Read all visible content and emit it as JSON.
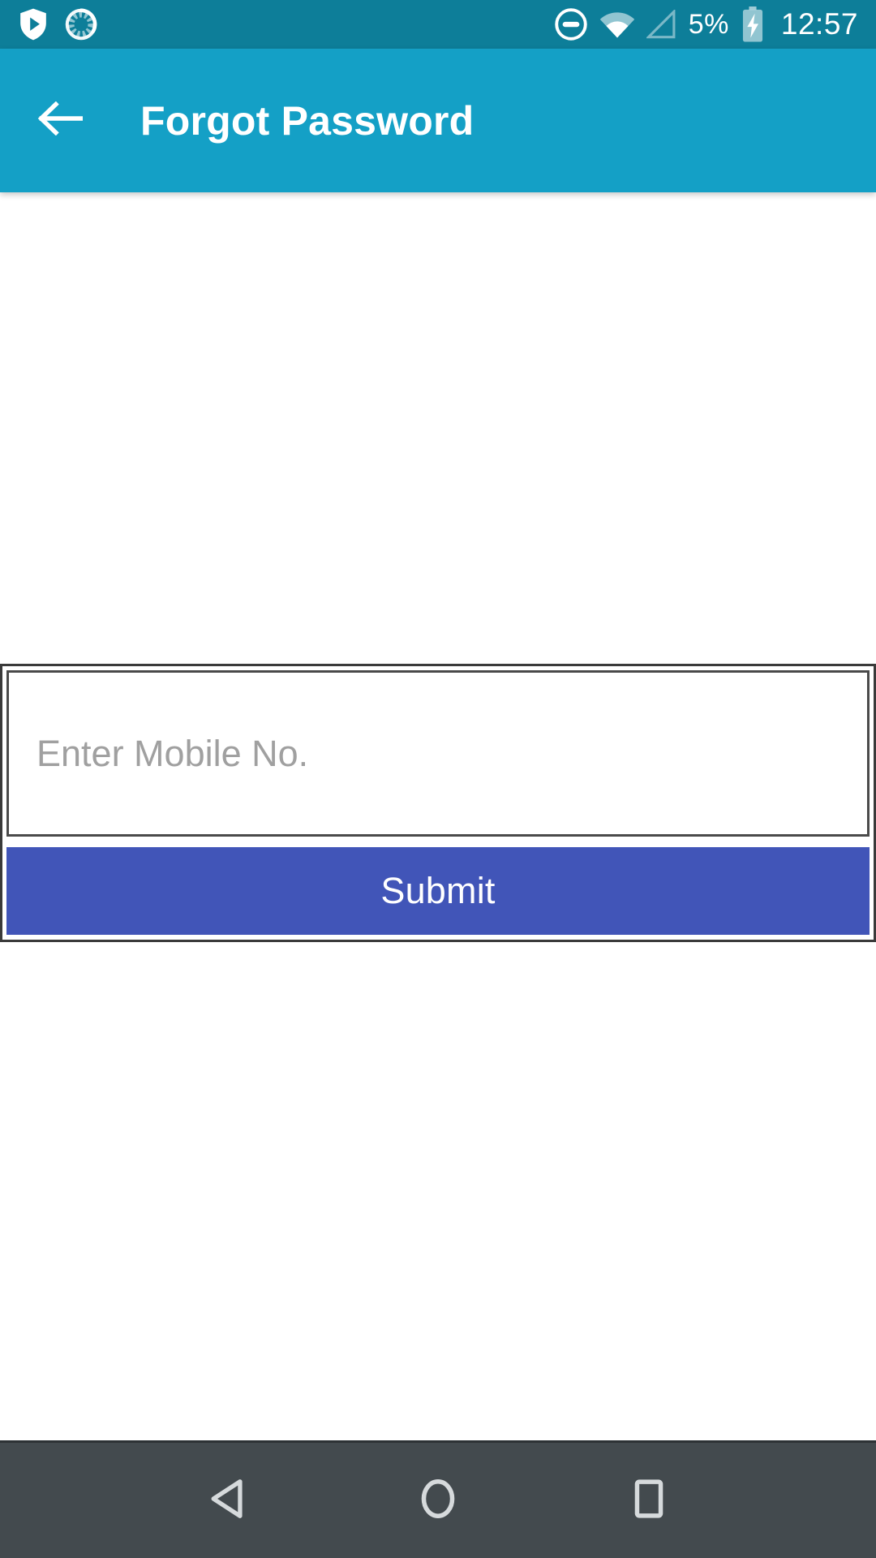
{
  "status_bar": {
    "background_color": "#0d7e99",
    "left_icons": [
      {
        "name": "shield-play-icon",
        "label": "shield-play"
      },
      {
        "name": "sync-spinner-icon",
        "label": "sync-spinner"
      }
    ],
    "right_icons": [
      {
        "name": "do-not-disturb-icon",
        "label": "do-not-disturb"
      },
      {
        "name": "wifi-icon",
        "label": "wifi"
      },
      {
        "name": "cellular-signal-icon",
        "label": "cellular-signal-empty"
      },
      {
        "name": "battery-charging-icon",
        "label": "battery-charging"
      }
    ],
    "battery_percent": "5%",
    "clock": "12:57"
  },
  "app_bar": {
    "background_color": "#14a0c6",
    "back_icon": "arrow-left-icon",
    "title": "Forgot Password"
  },
  "form": {
    "mobile_input": {
      "value": "",
      "placeholder": "Enter Mobile No."
    },
    "submit_label": "Submit",
    "submit_color": "#4155b8"
  },
  "nav_bar": {
    "background_color": "#434a4e",
    "buttons": [
      {
        "name": "nav-back-button",
        "icon": "triangle-left-icon"
      },
      {
        "name": "nav-home-button",
        "icon": "circle-icon"
      },
      {
        "name": "nav-recents-button",
        "icon": "square-icon"
      }
    ]
  }
}
